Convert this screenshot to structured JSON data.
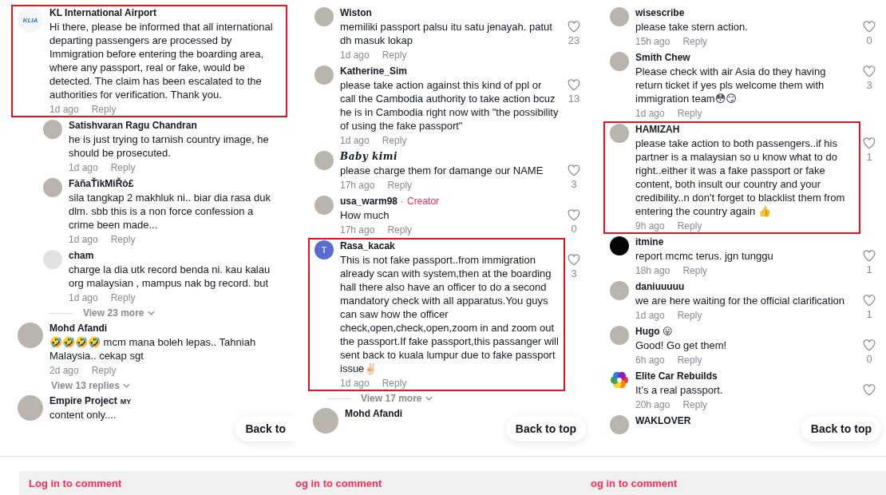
{
  "panels": [
    {
      "items": [
        {
          "kind": "comment",
          "avatar": {
            "kind": "logo",
            "text": "KLIA"
          },
          "author": "KL International Airport",
          "text": "Hi there, please be informed that all international departing passengers are processed by Immigration before entering the boarding area, where any passport, real or fake, would be detected. The claim has been escalated to the authorities for verification. Thank you.",
          "time": "1d ago",
          "reply": "Reply",
          "highlighted": true
        },
        {
          "kind": "reply",
          "avatar": {
            "kind": "photo"
          },
          "author": "Satishvaran Ragu Chandran",
          "text": "he is just trying to tarnish country image, he should be prosecuted.",
          "time": "1d ago",
          "reply": "Reply",
          "highlighted": false
        },
        {
          "kind": "reply",
          "avatar": {
            "kind": "photo"
          },
          "author": "FàñaŤìkMiŘò£",
          "text": "sila tangkap 2 makhluk ni.. biar dia rasa duk dlm. sbb this is a non force confession a crime been made...",
          "time": "1d ago",
          "reply": "Reply",
          "highlighted": false
        },
        {
          "kind": "reply",
          "avatar": {
            "kind": "blank"
          },
          "author": "cham",
          "text": "charge la dia utk record benda ni. kau kalau org malaysian , mampus nak bg record. but",
          "time": "1d ago",
          "reply": "Reply",
          "highlighted": false
        },
        {
          "kind": "more",
          "text": "View 23 more"
        },
        {
          "kind": "comment",
          "avatar": {
            "kind": "photo"
          },
          "author": "Mohd Afandi",
          "text": "🤣🤣🤣🤣 mcm mana boleh lepas.. Tahniah Malaysia.. cekap sgt",
          "time": "2d ago",
          "reply": "Reply",
          "highlighted": false
        },
        {
          "kind": "replies",
          "text": "View 13 replies"
        },
        {
          "kind": "comment",
          "avatar": {
            "kind": "photo"
          },
          "author": "Empire Project",
          "author_tag": "MY",
          "text": "content only....",
          "highlighted": false
        }
      ],
      "back_to_top": "Back to",
      "login": "Log in to comment"
    },
    {
      "items": [
        {
          "kind": "reply",
          "avatar": {
            "kind": "photo"
          },
          "author": "Wiston",
          "text": "memiliki passport palsu itu satu jenayah. patut dh masuk lokap",
          "time": "1d ago",
          "reply": "Reply",
          "heart": true,
          "likes": "23",
          "highlighted": false
        },
        {
          "kind": "reply",
          "avatar": {
            "kind": "photo"
          },
          "author": "Katherine_Sim",
          "text": "please take action against this kind of ppl or call the Cambodia authority to take action bcuz he is in Cambodia right now with \"the possibility of using the fake passport\"",
          "time": "1d ago",
          "reply": "Reply",
          "heart": true,
          "likes": "13",
          "highlighted": false
        },
        {
          "kind": "reply",
          "avatar": {
            "kind": "photo"
          },
          "author": "Baby kimi",
          "fancy": true,
          "text": "please charge them for damange our NAME",
          "time": "17h ago",
          "reply": "Reply",
          "heart": true,
          "likes": "3",
          "highlighted": false
        },
        {
          "kind": "reply",
          "avatar": {
            "kind": "photo"
          },
          "author": "usa_warm98",
          "separator": "·",
          "creator": "Creator",
          "text": "How much",
          "time": "17h ago",
          "reply": "Reply",
          "heart": true,
          "likes": "0",
          "highlighted": false
        },
        {
          "kind": "reply",
          "avatar": {
            "kind": "letter",
            "text": "T"
          },
          "author": "Rasa_kacak",
          "text": "This is not fake passport..from immigration already scan with system,then at the boarding hall there also have an officer to do a second mandatory check with all apparatus.You guys can saw how the officer check,open,check,open,zoom in and zoom out the passport.If fake passport,this passanger will sent back to kuala lumpur due to fake passport issue✌🏻",
          "time": "1d ago",
          "reply": "Reply",
          "heart": true,
          "likes": "3",
          "highlighted": true
        },
        {
          "kind": "more",
          "text": "View 17 more"
        },
        {
          "kind": "comment",
          "avatar": {
            "kind": "photo"
          },
          "author": "Mohd Afandi",
          "highlighted": false
        }
      ],
      "back_to_top": "Back to top",
      "login": "og in to comment"
    },
    {
      "items": [
        {
          "kind": "reply",
          "avatar": {
            "kind": "photo"
          },
          "author": "wisescribe",
          "text": "please take stern action.",
          "time": "15h ago",
          "reply": "Reply",
          "heart": true,
          "likes": "0",
          "highlighted": false
        },
        {
          "kind": "reply",
          "avatar": {
            "kind": "photo"
          },
          "author": "Smith Chew",
          "text": "Please check with air Asia do they having return ticket if yes pls welcome them with immigration team😳😏",
          "time": "1d ago",
          "reply": "Reply",
          "heart": true,
          "likes": "3",
          "highlighted": false
        },
        {
          "kind": "reply",
          "avatar": {
            "kind": "photo"
          },
          "author": "HAMIZAH",
          "text": "please take action to both passengers..if his partner is a malaysian so u know what to do right..either it was a fake passport or fake content, both insult our country and your credibility..n don't forget to blacklist them from entering the country again 👍",
          "time": "9h ago",
          "reply": "Reply",
          "heart": true,
          "likes": "1",
          "highlighted": true
        },
        {
          "kind": "reply",
          "avatar": {
            "kind": "dark"
          },
          "author": "itmine",
          "text": "report mcmc terus. jgn tunggu",
          "time": "18h ago",
          "reply": "Reply",
          "heart": true,
          "likes": "1",
          "highlighted": false
        },
        {
          "kind": "reply",
          "avatar": {
            "kind": "photo"
          },
          "author": "daniuuuuu",
          "text": "we are here waiting for the official clarification",
          "time": "1d ago",
          "reply": "Reply",
          "heart": true,
          "likes": "1",
          "highlighted": false
        },
        {
          "kind": "reply",
          "avatar": {
            "kind": "photo"
          },
          "author": "Hugo 😛",
          "text": "Good! Go get them!",
          "time": "6h ago",
          "reply": "Reply",
          "heart": true,
          "likes": "0",
          "highlighted": false
        },
        {
          "kind": "reply",
          "avatar": {
            "kind": "flower"
          },
          "author": "Elite Car Rebuilds",
          "text": "It’s a real passport.",
          "time": "20h ago",
          "reply": "Reply",
          "heart": true,
          "highlighted": false
        },
        {
          "kind": "reply",
          "avatar": {
            "kind": "photo"
          },
          "author": "WAKLOVER",
          "highlighted": false
        }
      ],
      "back_to_top": "Back to top",
      "login": "og in to comment"
    }
  ]
}
